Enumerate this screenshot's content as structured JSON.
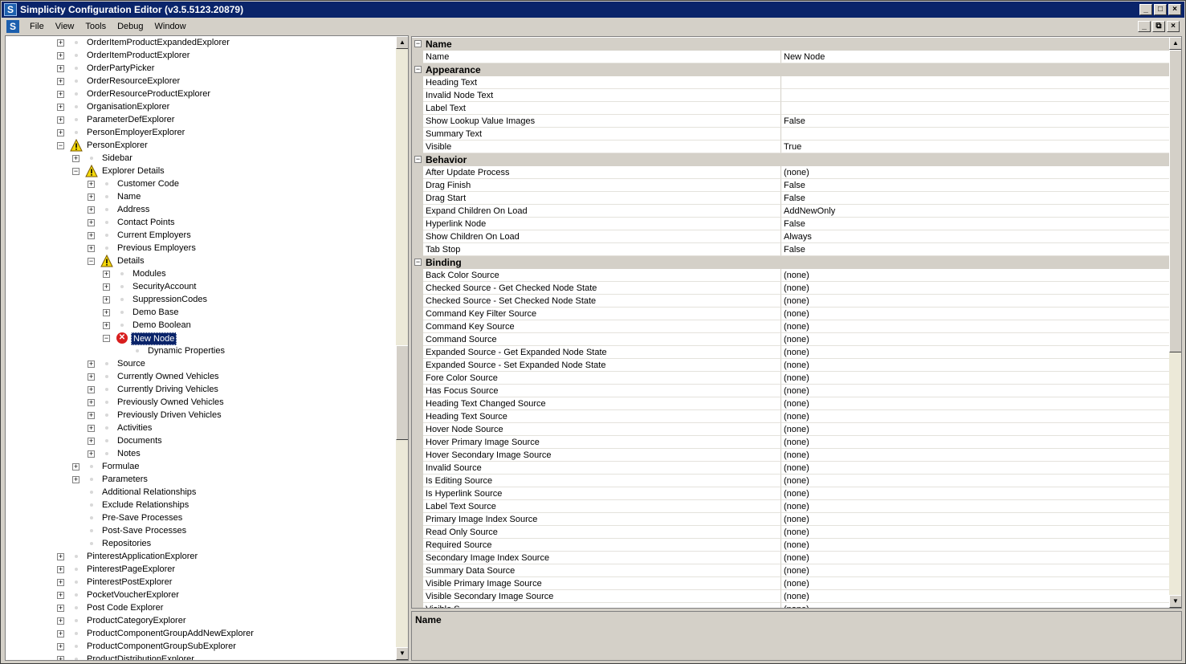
{
  "window": {
    "title": "Simplicity Configuration Editor (v3.5.5123.20879)",
    "app_icon_letter": "S",
    "controls": [
      "_",
      "□",
      "×"
    ],
    "mdi_controls": [
      "_",
      "⧉",
      "×"
    ]
  },
  "menu": [
    "File",
    "View",
    "Tools",
    "Debug",
    "Window"
  ],
  "tree": {
    "selected": "New Node",
    "items": [
      {
        "label": "OrderItemProductExpandedExplorer",
        "level": 0,
        "expander": "+",
        "icon": "bullet"
      },
      {
        "label": "OrderItemProductExplorer",
        "level": 0,
        "expander": "+",
        "icon": "bullet"
      },
      {
        "label": "OrderPartyPicker",
        "level": 0,
        "expander": "+",
        "icon": "bullet"
      },
      {
        "label": "OrderResourceExplorer",
        "level": 0,
        "expander": "+",
        "icon": "bullet"
      },
      {
        "label": "OrderResourceProductExplorer",
        "level": 0,
        "expander": "+",
        "icon": "bullet"
      },
      {
        "label": "OrganisationExplorer",
        "level": 0,
        "expander": "+",
        "icon": "bullet"
      },
      {
        "label": "ParameterDefExplorer",
        "level": 0,
        "expander": "+",
        "icon": "bullet"
      },
      {
        "label": "PersonEmployerExplorer",
        "level": 0,
        "expander": "+",
        "icon": "bullet"
      },
      {
        "label": "PersonExplorer",
        "level": 0,
        "expander": "−",
        "icon": "warning"
      },
      {
        "label": "Sidebar",
        "level": 1,
        "expander": "+",
        "icon": "bullet"
      },
      {
        "label": "Explorer Details",
        "level": 1,
        "expander": "−",
        "icon": "warning"
      },
      {
        "label": "Customer Code",
        "level": 2,
        "expander": "+",
        "icon": "bullet"
      },
      {
        "label": "Name",
        "level": 2,
        "expander": "+",
        "icon": "bullet"
      },
      {
        "label": "Address",
        "level": 2,
        "expander": "+",
        "icon": "bullet"
      },
      {
        "label": "Contact Points",
        "level": 2,
        "expander": "+",
        "icon": "bullet"
      },
      {
        "label": "Current Employers",
        "level": 2,
        "expander": "+",
        "icon": "bullet"
      },
      {
        "label": "Previous Employers",
        "level": 2,
        "expander": "+",
        "icon": "bullet"
      },
      {
        "label": "Details",
        "level": 2,
        "expander": "−",
        "icon": "warning"
      },
      {
        "label": "Modules",
        "level": 3,
        "expander": "+",
        "icon": "bullet"
      },
      {
        "label": "SecurityAccount",
        "level": 3,
        "expander": "+",
        "icon": "bullet"
      },
      {
        "label": "SuppressionCodes",
        "level": 3,
        "expander": "+",
        "icon": "bullet"
      },
      {
        "label": "Demo Base",
        "level": 3,
        "expander": "+",
        "icon": "bullet"
      },
      {
        "label": "Demo Boolean",
        "level": 3,
        "expander": "+",
        "icon": "bullet"
      },
      {
        "label": "New Node",
        "level": 3,
        "expander": "−",
        "icon": "error"
      },
      {
        "label": "Dynamic Properties",
        "level": 4,
        "expander": "",
        "icon": "bullet"
      },
      {
        "label": "Source",
        "level": 2,
        "expander": "+",
        "icon": "bullet"
      },
      {
        "label": "Currently Owned Vehicles",
        "level": 2,
        "expander": "+",
        "icon": "bullet"
      },
      {
        "label": "Currently Driving Vehicles",
        "level": 2,
        "expander": "+",
        "icon": "bullet"
      },
      {
        "label": "Previously Owned Vehicles",
        "level": 2,
        "expander": "+",
        "icon": "bullet"
      },
      {
        "label": "Previously Driven Vehicles",
        "level": 2,
        "expander": "+",
        "icon": "bullet"
      },
      {
        "label": "Activities",
        "level": 2,
        "expander": "+",
        "icon": "bullet"
      },
      {
        "label": "Documents",
        "level": 2,
        "expander": "+",
        "icon": "bullet"
      },
      {
        "label": "Notes",
        "level": 2,
        "expander": "+",
        "icon": "bullet"
      },
      {
        "label": "Formulae",
        "level": 1,
        "expander": "+",
        "icon": "bullet"
      },
      {
        "label": "Parameters",
        "level": 1,
        "expander": "+",
        "icon": "bullet"
      },
      {
        "label": "Additional Relationships",
        "level": 1,
        "expander": "",
        "icon": "bullet"
      },
      {
        "label": "Exclude Relationships",
        "level": 1,
        "expander": "",
        "icon": "bullet"
      },
      {
        "label": "Pre-Save Processes",
        "level": 1,
        "expander": "",
        "icon": "bullet"
      },
      {
        "label": "Post-Save Processes",
        "level": 1,
        "expander": "",
        "icon": "bullet"
      },
      {
        "label": "Repositories",
        "level": 1,
        "expander": "",
        "icon": "bullet"
      },
      {
        "label": "PinterestApplicationExplorer",
        "level": 0,
        "expander": "+",
        "icon": "bullet"
      },
      {
        "label": "PinterestPageExplorer",
        "level": 0,
        "expander": "+",
        "icon": "bullet"
      },
      {
        "label": "PinterestPostExplorer",
        "level": 0,
        "expander": "+",
        "icon": "bullet"
      },
      {
        "label": "PocketVoucherExplorer",
        "level": 0,
        "expander": "+",
        "icon": "bullet"
      },
      {
        "label": "Post Code Explorer",
        "level": 0,
        "expander": "+",
        "icon": "bullet"
      },
      {
        "label": "ProductCategoryExplorer",
        "level": 0,
        "expander": "+",
        "icon": "bullet"
      },
      {
        "label": "ProductComponentGroupAddNewExplorer",
        "level": 0,
        "expander": "+",
        "icon": "bullet"
      },
      {
        "label": "ProductComponentGroupSubExplorer",
        "level": 0,
        "expander": "+",
        "icon": "bullet"
      },
      {
        "label": "ProductDistributionExplorer",
        "level": 0,
        "expander": "+",
        "icon": "bullet"
      }
    ]
  },
  "properties": {
    "categories": [
      {
        "name": "Name",
        "rows": [
          {
            "name": "Name",
            "value": "New Node"
          }
        ]
      },
      {
        "name": "Appearance",
        "rows": [
          {
            "name": "Heading Text",
            "value": ""
          },
          {
            "name": "Invalid Node Text",
            "value": ""
          },
          {
            "name": "Label Text",
            "value": ""
          },
          {
            "name": "Show Lookup Value Images",
            "value": "False"
          },
          {
            "name": "Summary Text",
            "value": ""
          },
          {
            "name": "Visible",
            "value": "True"
          }
        ]
      },
      {
        "name": "Behavior",
        "rows": [
          {
            "name": "After Update Process",
            "value": "(none)"
          },
          {
            "name": "Drag Finish",
            "value": "False"
          },
          {
            "name": "Drag Start",
            "value": "False"
          },
          {
            "name": "Expand Children On Load",
            "value": "AddNewOnly"
          },
          {
            "name": "Hyperlink Node",
            "value": "False"
          },
          {
            "name": "Show Children On Load",
            "value": "Always"
          },
          {
            "name": "Tab Stop",
            "value": "False"
          }
        ]
      },
      {
        "name": "Binding",
        "rows": [
          {
            "name": "Back Color Source",
            "value": "(none)"
          },
          {
            "name": "Checked Source - Get Checked Node State",
            "value": "(none)"
          },
          {
            "name": "Checked Source - Set Checked Node State",
            "value": "(none)"
          },
          {
            "name": "Command Key Filter Source",
            "value": "(none)"
          },
          {
            "name": "Command Key Source",
            "value": "(none)"
          },
          {
            "name": "Command Source",
            "value": "(none)"
          },
          {
            "name": "Expanded Source - Get Expanded Node State",
            "value": "(none)"
          },
          {
            "name": "Expanded Source - Set Expanded Node State",
            "value": "(none)"
          },
          {
            "name": "Fore Color Source",
            "value": "(none)"
          },
          {
            "name": "Has Focus Source",
            "value": "(none)"
          },
          {
            "name": "Heading Text Changed Source",
            "value": "(none)"
          },
          {
            "name": "Heading Text Source",
            "value": "(none)"
          },
          {
            "name": "Hover Node Source",
            "value": "(none)"
          },
          {
            "name": "Hover Primary Image Source",
            "value": "(none)"
          },
          {
            "name": "Hover Secondary Image Source",
            "value": "(none)"
          },
          {
            "name": "Invalid Source",
            "value": "(none)"
          },
          {
            "name": "Is Editing Source",
            "value": "(none)"
          },
          {
            "name": "Is Hyperlink Source",
            "value": "(none)"
          },
          {
            "name": "Label Text Source",
            "value": "(none)"
          },
          {
            "name": "Primary Image Index Source",
            "value": "(none)"
          },
          {
            "name": "Read Only Source",
            "value": "(none)"
          },
          {
            "name": "Required Source",
            "value": "(none)"
          },
          {
            "name": "Secondary Image Index Source",
            "value": "(none)"
          },
          {
            "name": "Summary Data Source",
            "value": "(none)"
          },
          {
            "name": "Visible Primary Image Source",
            "value": "(none)"
          },
          {
            "name": "Visible Secondary Image Source",
            "value": "(none)"
          },
          {
            "name": "Visible S...",
            "value": "(none)"
          }
        ]
      }
    ]
  },
  "description": {
    "title": "Name"
  },
  "colors": {
    "titlebar": "#0a246a",
    "selection": "#0a246a",
    "window_bg": "#d4d0c8",
    "warning": "#f5d90a",
    "error": "#d81e1e"
  }
}
